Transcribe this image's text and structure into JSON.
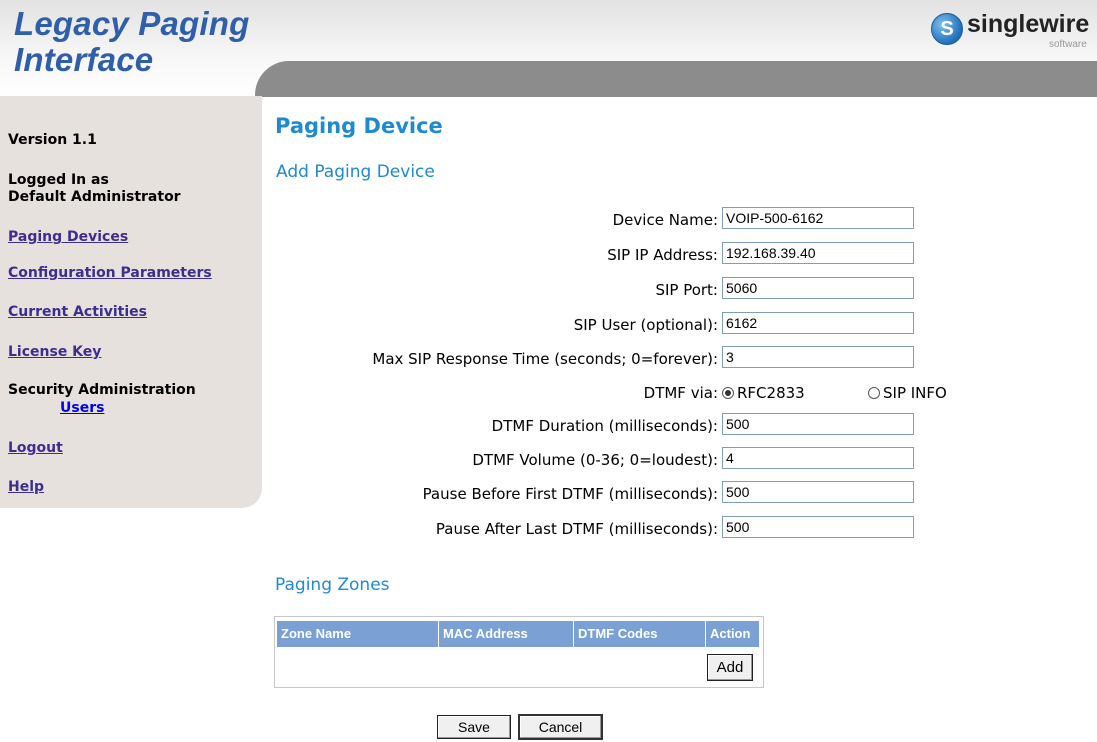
{
  "header": {
    "title_line1": "Legacy Paging",
    "title_line2": "Interface",
    "logo_letter": "S",
    "logo_text": "singlewire",
    "logo_sub": "software"
  },
  "sidebar": {
    "version": "Version 1.1",
    "logged_in_line1": "Logged In as",
    "logged_in_line2": "Default Administrator",
    "links": {
      "paging_devices": "Paging Devices",
      "configuration_parameters": "Configuration Parameters",
      "current_activities": "Current Activities",
      "license_key": "License Key",
      "security_administration": "Security Administration",
      "users": "Users",
      "logout": "Logout",
      "help": "Help"
    }
  },
  "main": {
    "page_title": "Paging Device",
    "section_title": "Add Paging Device",
    "fields": {
      "device_name": {
        "label": "Device Name:",
        "value": "VOIP-500-6162"
      },
      "sip_ip": {
        "label": "SIP IP Address:",
        "value": "192.168.39.40"
      },
      "sip_port": {
        "label": "SIP Port:",
        "value": "5060"
      },
      "sip_user": {
        "label": "SIP User (optional):",
        "value": "6162"
      },
      "max_sip": {
        "label": "Max SIP Response Time (seconds; 0=forever):",
        "value": "3"
      },
      "dtmf_via": {
        "label": "DTMF via:",
        "option1": "RFC2833",
        "option2": "SIP INFO",
        "selected": "RFC2833"
      },
      "dtmf_duration": {
        "label": "DTMF Duration (milliseconds):",
        "value": "500"
      },
      "dtmf_volume": {
        "label": "DTMF Volume (0-36; 0=loudest):",
        "value": "4"
      },
      "pause_before": {
        "label": "Pause Before First DTMF (milliseconds):",
        "value": "500"
      },
      "pause_after": {
        "label": "Pause After Last DTMF (milliseconds):",
        "value": "500"
      }
    },
    "zones": {
      "title": "Paging Zones",
      "headers": [
        "Zone Name",
        "MAC Address",
        "DTMF Codes",
        "Action"
      ],
      "add_label": "Add"
    },
    "save_label": "Save",
    "cancel_label": "Cancel"
  },
  "colors": {
    "title_blue": "#2f5fa8",
    "heading_blue": "#1e8ad0",
    "sidebar_bg": "#e7e1de",
    "table_header": "#7aa0d4"
  }
}
